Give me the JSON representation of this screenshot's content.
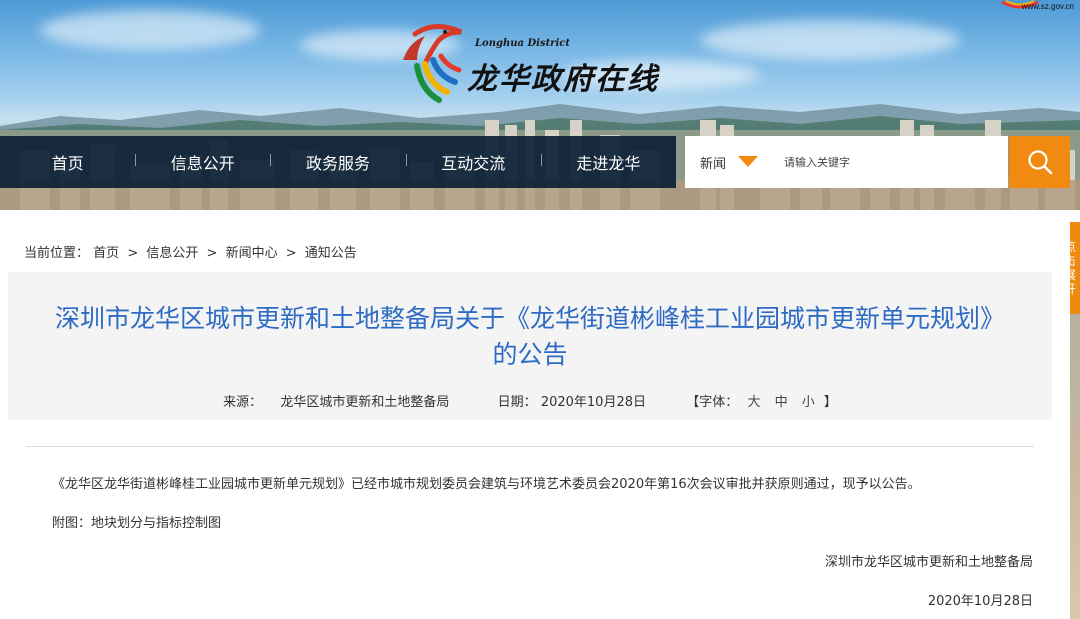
{
  "site": {
    "logo_subtitle": "Longhua District",
    "logo_title": "龙华政府在线",
    "corner_url": "www.sz.gov.cn"
  },
  "nav": {
    "items": [
      {
        "label": "首页"
      },
      {
        "label": "信息公开"
      },
      {
        "label": "政务服务"
      },
      {
        "label": "互动交流"
      },
      {
        "label": "走进龙华"
      }
    ]
  },
  "search": {
    "scope": "新闻",
    "placeholder": "请输入关键字",
    "icon": "search-icon"
  },
  "side_tab": {
    "chars": [
      "点",
      "击",
      "展",
      "开"
    ]
  },
  "breadcrumb": {
    "label": "当前位置：",
    "items": [
      "首页",
      "信息公开",
      "新闻中心",
      "通知公告"
    ],
    "separator": ">"
  },
  "article": {
    "title_line1": "深圳市龙华区城市更新和土地整备局关于《龙华街道彬峰桂工业园城市更新单元规划》",
    "title_line2": "的公告",
    "source_label": "来源：",
    "source_value": "龙华区城市更新和土地整备局",
    "date_label": "日期：",
    "date_value": "2020年10月28日",
    "font_label_open": "【字体：",
    "font_large": "大",
    "font_medium": "中",
    "font_small": "小",
    "font_label_close": "】",
    "body": "《龙华区龙华街道彬峰桂工业园城市更新单元规划》已经市城市规划委员会建筑与环境艺术委员会2020年第16次会议审批并获原则通过，现予以公告。",
    "attachment": "附图：地块划分与指标控制图",
    "signature": "深圳市龙华区城市更新和土地整备局",
    "signature_date": "2020年10月28日"
  },
  "colors": {
    "nav_bg": "#0c2036",
    "accent_orange": "#f08a10",
    "title_blue": "#2d6bc4"
  }
}
